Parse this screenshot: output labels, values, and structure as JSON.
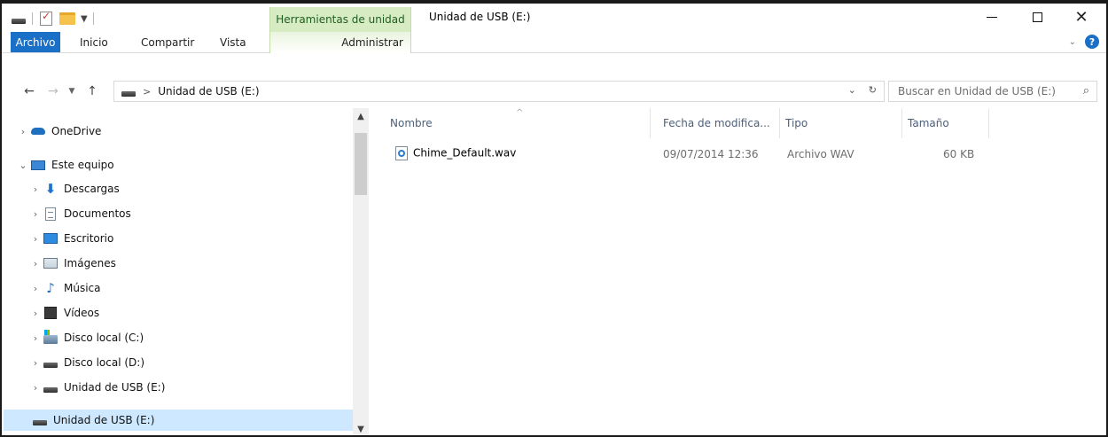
{
  "window": {
    "title": "Unidad de USB (E:)",
    "context_tab_group": "Herramientas de unidad",
    "controls": {
      "minimize": "—",
      "maximize": "☐",
      "close": "✕"
    }
  },
  "ribbon": {
    "tabs": [
      "Archivo",
      "Inicio",
      "Compartir",
      "Vista"
    ],
    "context_tab": "Administrar",
    "help": "?"
  },
  "address_bar": {
    "path_label": "Unidad de USB (E:)",
    "separator": ">",
    "search_placeholder": "Buscar en Unidad de USB (E:)"
  },
  "nav_pane": {
    "items": [
      {
        "label": "OneDrive",
        "icon": "onedrive-icon"
      },
      {
        "label": "Este equipo",
        "icon": "computer-icon"
      },
      {
        "label": "Descargas",
        "icon": "downloads-icon"
      },
      {
        "label": "Documentos",
        "icon": "documents-icon"
      },
      {
        "label": "Escritorio",
        "icon": "desktop-icon"
      },
      {
        "label": "Imágenes",
        "icon": "pictures-icon"
      },
      {
        "label": "Música",
        "icon": "music-icon"
      },
      {
        "label": "Vídeos",
        "icon": "videos-icon"
      },
      {
        "label": "Disco local (C:)",
        "icon": "system-drive-icon"
      },
      {
        "label": "Disco local (D:)",
        "icon": "drive-icon"
      },
      {
        "label": "Unidad de USB (E:)",
        "icon": "usb-drive-icon"
      },
      {
        "label": "Unidad de USB (E:)",
        "icon": "usb-drive-icon",
        "selected": true
      }
    ]
  },
  "file_list": {
    "columns": [
      "Nombre",
      "Fecha de modifica...",
      "Tipo",
      "Tamaño"
    ],
    "rows": [
      {
        "name": "Chime_Default.wav",
        "modified": "09/07/2014 12:36",
        "type": "Archivo WAV",
        "size": "60 KB"
      }
    ]
  }
}
